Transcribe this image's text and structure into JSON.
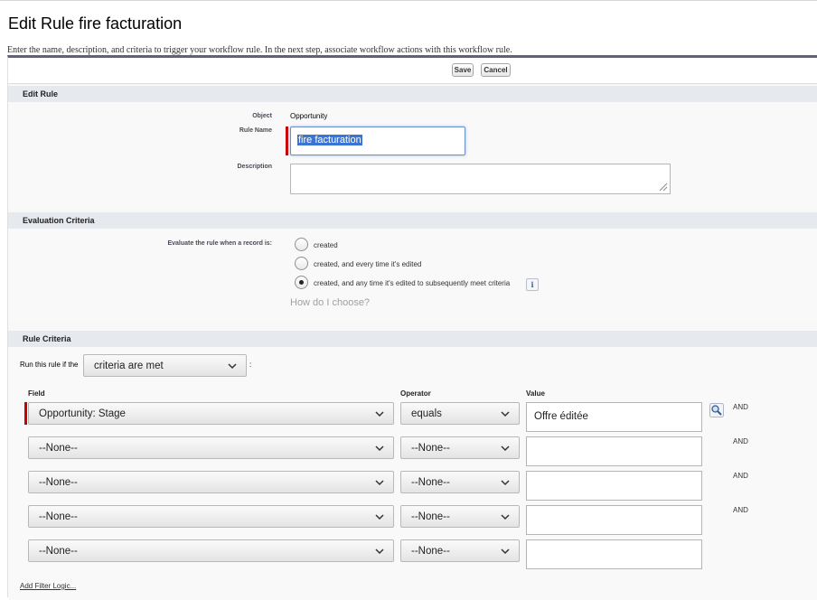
{
  "page": {
    "title": "Edit Rule fire facturation",
    "description": "Enter the name, description, and criteria to trigger your workflow rule. In the next step, associate workflow actions with this workflow rule."
  },
  "buttons": {
    "save": "Save",
    "cancel": "Cancel"
  },
  "edit_rule": {
    "heading": "Edit Rule",
    "object_label": "Object",
    "object_value": "Opportunity",
    "rule_name_label": "Rule Name",
    "rule_name_value": "fire facturation",
    "description_label": "Description",
    "description_value": ""
  },
  "evaluation": {
    "heading": "Evaluation Criteria",
    "prompt": "Evaluate the rule when a record is:",
    "options": [
      {
        "label": "created",
        "selected": false
      },
      {
        "label": "created, and every time it's edited",
        "selected": false
      },
      {
        "label": "created, and any time it's edited to subsequently meet criteria",
        "selected": true
      }
    ],
    "info_icon": "info-icon",
    "help_link": "How do I choose?"
  },
  "rule_criteria": {
    "heading": "Rule Criteria",
    "run_prefix": "Run this rule if the",
    "run_select": "criteria are met",
    "run_suffix": ":",
    "columns": {
      "field": "Field",
      "operator": "Operator",
      "value": "Value"
    },
    "rows": [
      {
        "field": "Opportunity: Stage",
        "operator": "equals",
        "value": "Offre éditée",
        "connector": "AND",
        "required": true,
        "lookup": true
      },
      {
        "field": "--None--",
        "operator": "--None--",
        "value": "",
        "connector": "AND"
      },
      {
        "field": "--None--",
        "operator": "--None--",
        "value": "",
        "connector": "AND"
      },
      {
        "field": "--None--",
        "operator": "--None--",
        "value": "",
        "connector": "AND"
      },
      {
        "field": "--None--",
        "operator": "--None--",
        "value": "",
        "connector": ""
      }
    ],
    "add_filter_logic": "Add Filter Logic..."
  },
  "colors": {
    "section_header_bg": "#e6e9ee",
    "required_marker": "#cc0000",
    "selection_highlight": "#3875d7",
    "panel_top_border": "#5f6375"
  }
}
